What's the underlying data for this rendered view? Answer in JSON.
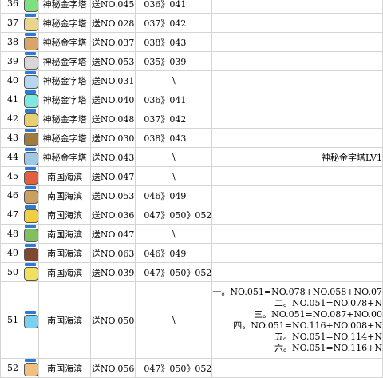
{
  "rows": [
    {
      "no": "36",
      "area": "神秘金字塔",
      "send": "送NO.045",
      "route": "036》041",
      "note": "",
      "color": "#7fe07f"
    },
    {
      "no": "37",
      "area": "神秘金字塔",
      "send": "送NO.028",
      "route": "037》042",
      "note": "",
      "color": "#e9d58a"
    },
    {
      "no": "38",
      "area": "神秘金字塔",
      "send": "送NO.037",
      "route": "038》043",
      "note": "",
      "color": "#d9a66a"
    },
    {
      "no": "39",
      "area": "神秘金字塔",
      "send": "送NO.053",
      "route": "035》039",
      "note": "",
      "color": "#d7d7d7"
    },
    {
      "no": "40",
      "area": "神秘金字塔",
      "send": "送NO.031",
      "route": "\\",
      "note": "",
      "color": "#b7d7f0"
    },
    {
      "no": "41",
      "area": "神秘金字塔",
      "send": "送NO.040",
      "route": "036》041",
      "note": "",
      "color": "#7fe8e0"
    },
    {
      "no": "42",
      "area": "神秘金字塔",
      "send": "送NO.048",
      "route": "037》042",
      "note": "",
      "color": "#e8d070"
    },
    {
      "no": "43",
      "area": "神秘金字塔",
      "send": "送NO.030",
      "route": "038》043",
      "note": "",
      "color": "#a07a40"
    },
    {
      "no": "44",
      "area": "神秘金字塔",
      "send": "送NO.043",
      "route": "\\",
      "note": "神秘金字塔LV1",
      "color": "#9fc8e8"
    },
    {
      "no": "45",
      "area": "南国海滨",
      "send": "送NO.047",
      "route": "\\",
      "note": "",
      "color": "#e06040"
    },
    {
      "no": "46",
      "area": "南国海滨",
      "send": "送NO.053",
      "route": "046》049",
      "note": "",
      "color": "#caa060"
    },
    {
      "no": "47",
      "area": "南国海滨",
      "send": "送NO.036",
      "route": "047》050》052",
      "note": "",
      "color": "#f0d040"
    },
    {
      "no": "48",
      "area": "南国海滨",
      "send": "送NO.047",
      "route": "\\",
      "note": "",
      "color": "#80c060"
    },
    {
      "no": "49",
      "area": "南国海滨",
      "send": "送NO.063",
      "route": "046》049",
      "note": "",
      "color": "#804830"
    },
    {
      "no": "50",
      "area": "南国海滨",
      "send": "送NO.039",
      "route": "047》050》052",
      "note": "",
      "color": "#f0e060"
    },
    {
      "no": "51",
      "area": "南国海滨",
      "send": "送NO.050",
      "route": "\\",
      "note_lines": [
        "一。NO.051=NO.078+NO.058+NO.07",
        "二。NO.051=NO.078+N",
        "三。NO.051=NO.087+NO.00",
        "四。NO.051=NO.116+NO.008+N",
        "五。NO.051=NO.114+N",
        "六。NO.051=NO.116+N"
      ],
      "color": "#7ad0f0"
    },
    {
      "no": "52",
      "area": "南国海滨",
      "send": "送NO.056",
      "route": "047》050》052",
      "note": "",
      "color": "#f0c080"
    }
  ]
}
